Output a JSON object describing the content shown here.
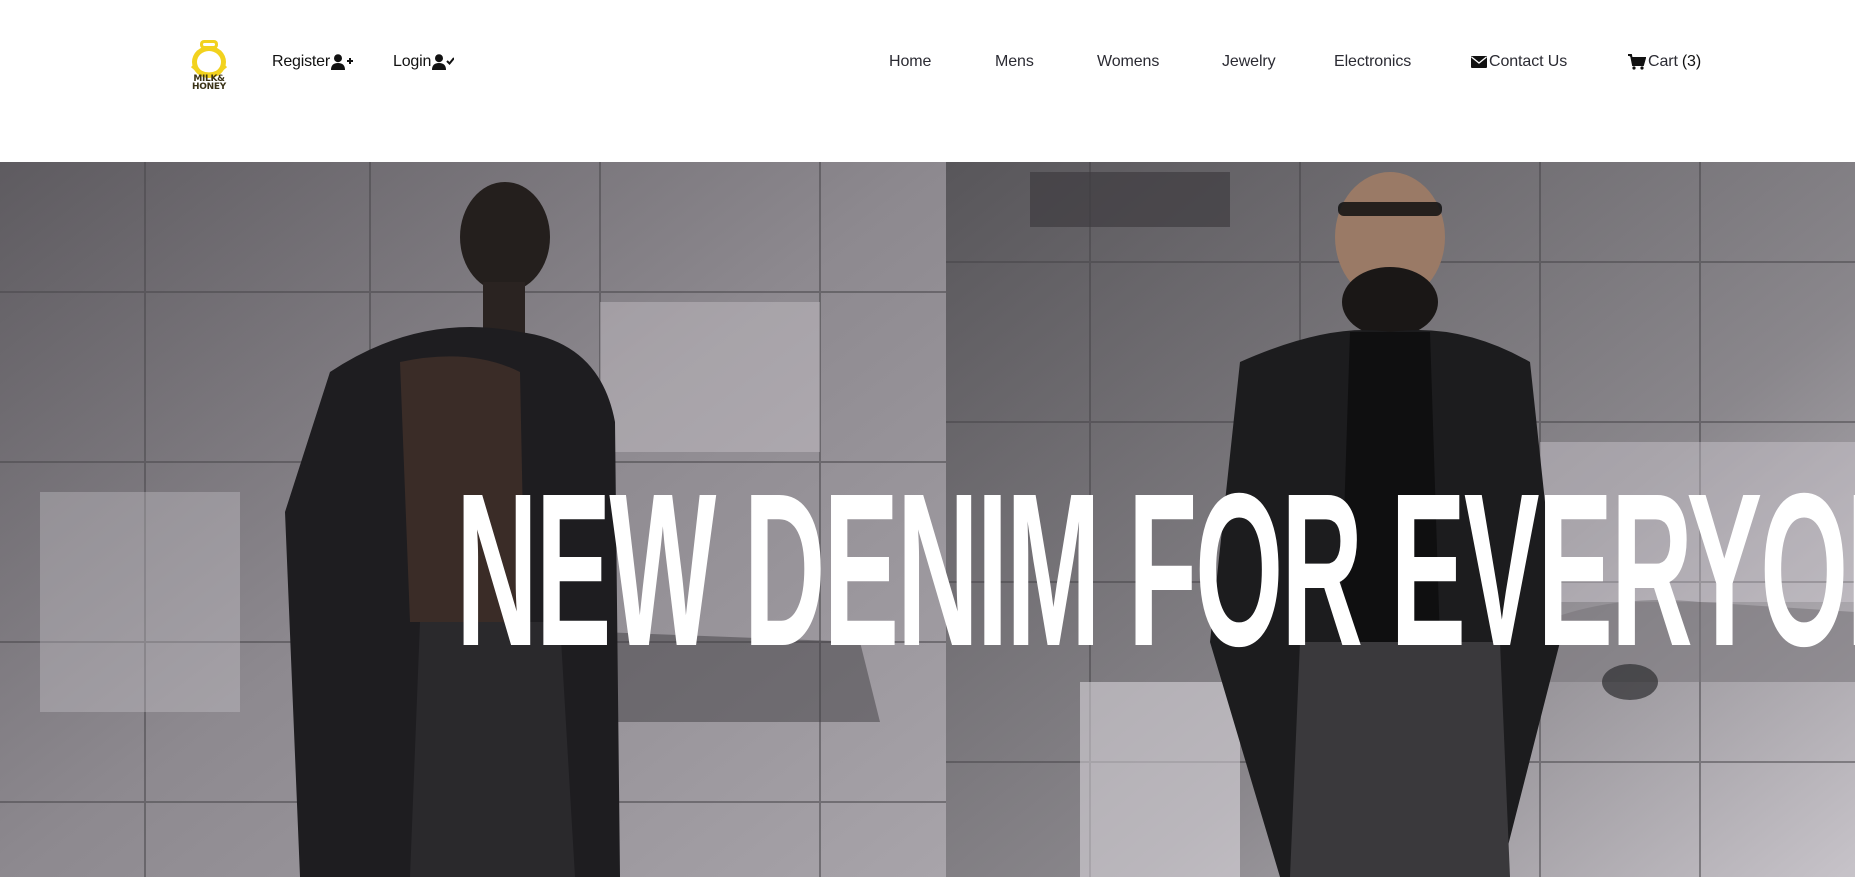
{
  "brand": {
    "logo_line1": "MILK&",
    "logo_line2": "HONEY",
    "accent_color": "#f2d21e"
  },
  "auth": {
    "register_label": "Register",
    "register_icon": "user-plus-icon",
    "login_label": "Login",
    "login_icon": "user-check-icon"
  },
  "nav": {
    "items": [
      {
        "label": "Home"
      },
      {
        "label": "Mens"
      },
      {
        "label": "Womens"
      },
      {
        "label": "Jewelry"
      },
      {
        "label": "Electronics"
      }
    ],
    "contact_label": "Contact Us",
    "contact_icon": "envelope-icon",
    "cart_label": "Cart",
    "cart_count": "(3)",
    "cart_icon": "shopping-cart-icon"
  },
  "hero": {
    "headline": "NEW DENIM FOR EVERYONE"
  }
}
